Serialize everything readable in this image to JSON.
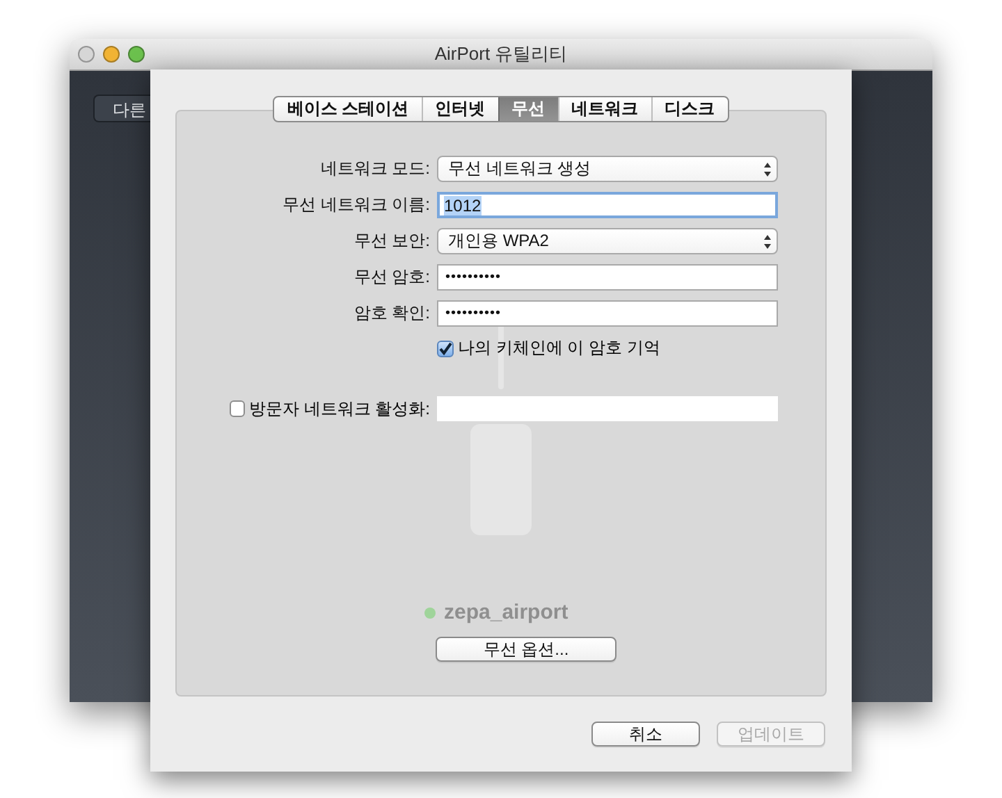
{
  "window": {
    "title": "AirPort 유틸리티",
    "background_button": "다른"
  },
  "sheet": {
    "tabs": [
      {
        "label": "베이스 스테이션",
        "selected": false
      },
      {
        "label": "인터넷",
        "selected": false
      },
      {
        "label": "무선",
        "selected": true
      },
      {
        "label": "네트워크",
        "selected": false
      },
      {
        "label": "디스크",
        "selected": false
      }
    ],
    "fields": [
      {
        "kind": "popup",
        "label": "네트워크 모드:",
        "value": "무선 네트워크 생성",
        "focused": false
      },
      {
        "kind": "text",
        "label": "무선 네트워크 이름:",
        "value": "1012",
        "focused": true
      },
      {
        "kind": "popup",
        "label": "무선 보안:",
        "value": "개인용 WPA2",
        "focused": false
      },
      {
        "kind": "password",
        "label": "무선 암호:",
        "value": "••••••••••",
        "focused": false
      },
      {
        "kind": "password",
        "label": "암호 확인:",
        "value": "••••••••••",
        "focused": false
      }
    ],
    "remember_checkbox": {
      "label": "나의 키체인에 이 암호 기억",
      "checked": true
    },
    "guest_checkbox": {
      "label": "방문자 네트워크 활성화:",
      "checked": false
    },
    "device_name": "zepa_airport",
    "options_button": "무선 옵션...",
    "buttons": [
      {
        "label": "취소",
        "disabled": false
      },
      {
        "label": "업데이트",
        "disabled": true
      }
    ]
  }
}
